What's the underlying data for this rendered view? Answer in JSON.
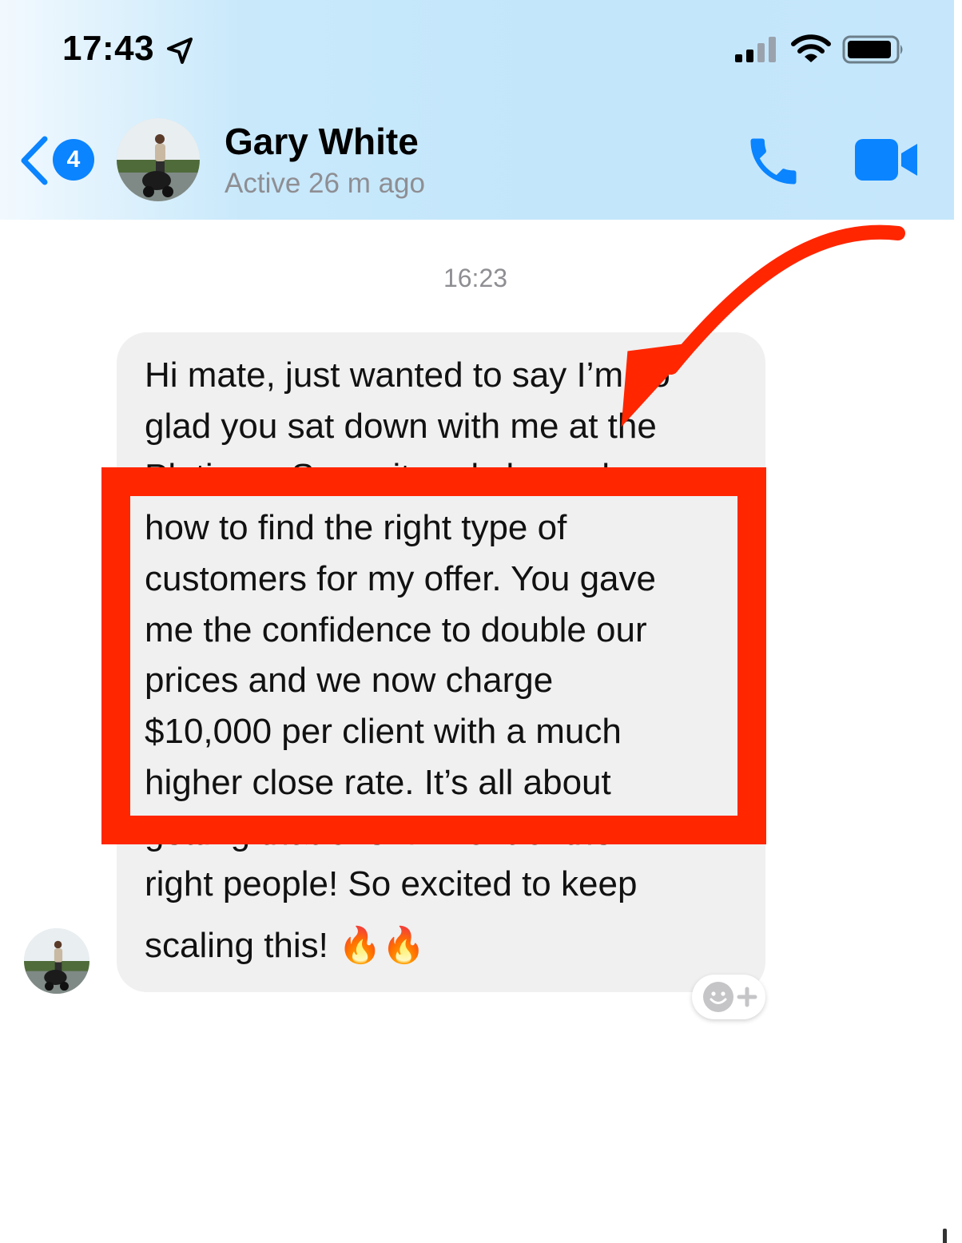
{
  "status_bar": {
    "time": "17:43"
  },
  "header": {
    "back_badge_count": "4",
    "contact_name": "Gary White",
    "contact_status": "Active 26 m ago"
  },
  "conversation": {
    "timestamp": "16:23",
    "message_lines": [
      "Hi mate, just wanted to say I’m so",
      "glad you sat down with me at the",
      "Platinum Summit and showed me",
      "how to find the right type of",
      "customers for my offer. You gave",
      "me the confidence to double our",
      "prices and we now charge",
      "$10,000 per client with a much",
      "higher close rate. It’s all about",
      "getting that offer in front of the",
      "right people! So excited to keep",
      "scaling this! 🔥🔥"
    ]
  },
  "colors": {
    "accent": "#0a84ff",
    "highlight": "#ff2600",
    "bubble": "#f0f0f0"
  },
  "icons": [
    "location-arrow-icon",
    "signal-icon",
    "wifi-icon",
    "battery-icon",
    "back-chevron-icon",
    "phone-icon",
    "video-camera-icon",
    "add-reaction-icon"
  ]
}
